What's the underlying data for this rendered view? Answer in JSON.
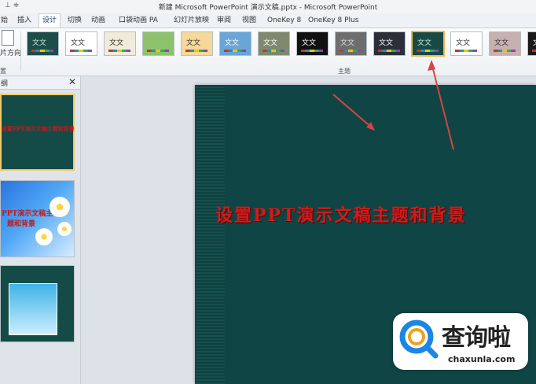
{
  "app": {
    "window_title": "新建 Microsoft PowerPoint 演示文稿.pptx - Microsoft PowerPoint",
    "qa": "⊥ ≑"
  },
  "tabs": [
    {
      "label": "始"
    },
    {
      "label": "插入"
    },
    {
      "label": "设计"
    },
    {
      "label": "切换"
    },
    {
      "label": "动画"
    },
    {
      "label": "口袋动画 PA"
    },
    {
      "label": "幻灯片放映"
    },
    {
      "label": "审阅"
    },
    {
      "label": "视图"
    },
    {
      "label": "OneKey 8"
    },
    {
      "label": "OneKey 8 Plus"
    }
  ],
  "ribbon": {
    "page_setup_label": "片方向",
    "page_group_label": "置",
    "themes_group_label": "主题",
    "themes": [
      {
        "text": "文文",
        "bg": "#1c4d49",
        "fg": "#c8e6d0"
      },
      {
        "text": "文文",
        "bg": "#ffffff",
        "fg": "#333333"
      },
      {
        "text": "文文",
        "bg": "#f1ecd9",
        "fg": "#333333"
      },
      {
        "text": "",
        "bg": "#8cc26b",
        "fg": "#333333"
      },
      {
        "text": "文文",
        "bg": "#f5d89a",
        "fg": "#333333"
      },
      {
        "text": "文文",
        "bg": "#69a5d6",
        "fg": "#ffffff"
      },
      {
        "text": "文文",
        "bg": "#7d8a6e",
        "fg": "#ffffff"
      },
      {
        "text": "文文",
        "bg": "#111111",
        "fg": "#ffffff"
      },
      {
        "text": "文文",
        "bg": "#6e6e6e",
        "fg": "#dddddd"
      },
      {
        "text": "文文",
        "bg": "#2a2f3a",
        "fg": "#ffffff"
      },
      {
        "text": "文文",
        "bg": "#174a45",
        "fg": "#c8e6d0"
      },
      {
        "text": "文文",
        "bg": "#ffffff",
        "fg": "#333333"
      },
      {
        "text": "文文",
        "bg": "#c7b0b0",
        "fg": "#333333"
      },
      {
        "text": "文",
        "bg": "#1a1a1a",
        "fg": "#ffffff"
      }
    ]
  },
  "thumbnail_pane": {
    "header_label": "纲",
    "slides": [
      {
        "title": "设置PPT演示文稿主题和背景"
      },
      {
        "title_line1": "PPT演示文稿主",
        "title_line2": "题和背景"
      },
      {
        "title": ""
      }
    ]
  },
  "slide": {
    "title": "设置PPT演示文稿主题和背景"
  },
  "watermark": {
    "cn": "查询啦",
    "en": "chaxunla.com"
  },
  "colors": {
    "accent": "#1f3f70",
    "slide_bg": "#0f4544",
    "title_red": "#d11b1b",
    "arrow_red": "#d64545"
  }
}
